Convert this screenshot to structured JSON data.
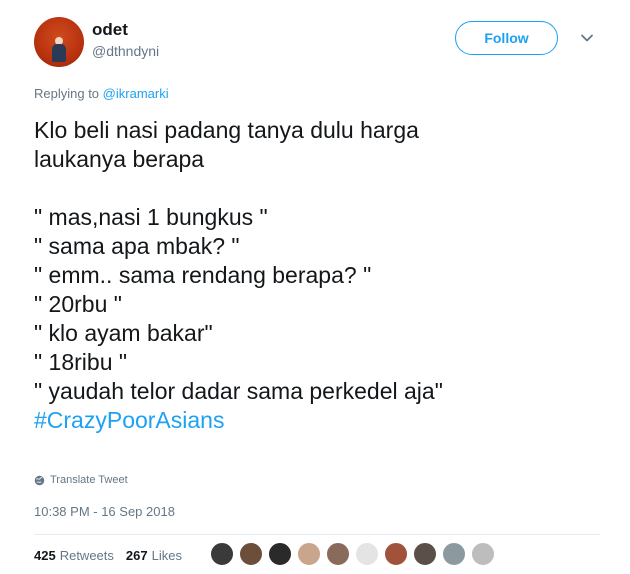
{
  "author": {
    "name": "odet",
    "handle": "@dthndyni"
  },
  "follow_button": {
    "label": "Follow"
  },
  "reply": {
    "prefix": "Replying to",
    "mention": "@ikramarki"
  },
  "tweet": {
    "lines": [
      "Klo beli nasi padang tanya dulu harga",
      "laukanya berapa",
      "",
      "\" mas,nasi 1 bungkus \"",
      "\" sama apa mbak? \"",
      "\" emm.. sama rendang berapa? \"",
      "\" 20rbu \"",
      "\" klo ayam bakar\"",
      "\" 18ribu \"",
      "\" yaudah telor dadar sama perkedel aja\""
    ],
    "hashtag": "#CrazyPoorAsians"
  },
  "translate_label": "Translate Tweet",
  "timestamp": "10:38 PM - 16 Sep 2018",
  "stats": {
    "retweets_count": "425",
    "retweets_label": "Retweets",
    "likes_count": "267",
    "likes_label": "Likes"
  },
  "liker_colors": [
    "#3a3a3a",
    "#6b4f3a",
    "#2a2a2a",
    "#c9a58b",
    "#8a6a5a",
    "#e4e4e4",
    "#a0523a",
    "#5b4f4a",
    "#8c9aa0",
    "#bdbdbd"
  ]
}
